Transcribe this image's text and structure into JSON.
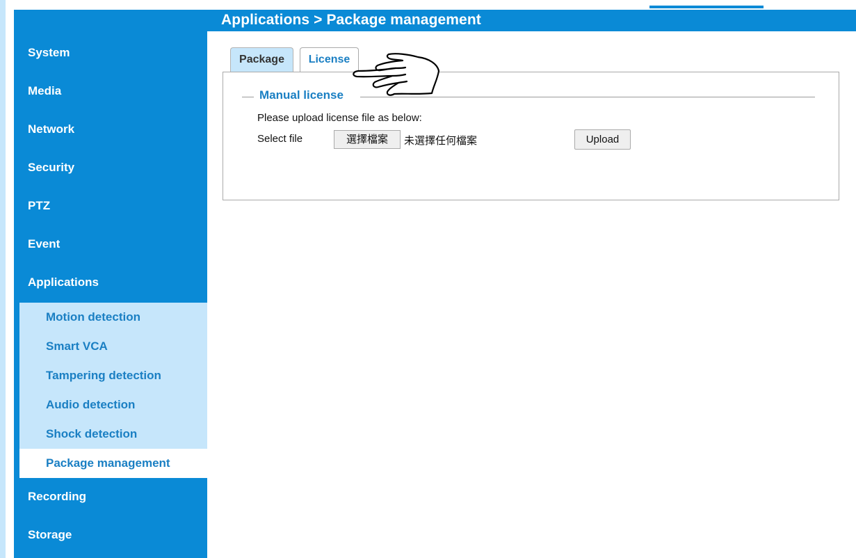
{
  "header": {
    "breadcrumb": "Applications  > Package management"
  },
  "sidebar": {
    "items": [
      {
        "label": "System"
      },
      {
        "label": "Media"
      },
      {
        "label": "Network"
      },
      {
        "label": "Security"
      },
      {
        "label": "PTZ"
      },
      {
        "label": "Event"
      },
      {
        "label": "Applications"
      },
      {
        "label": "Recording"
      },
      {
        "label": "Storage"
      }
    ],
    "submenu": [
      {
        "label": "Motion detection"
      },
      {
        "label": "Smart VCA"
      },
      {
        "label": "Tampering detection"
      },
      {
        "label": "Audio detection"
      },
      {
        "label": "Shock detection"
      },
      {
        "label": "Package management",
        "active": true
      }
    ]
  },
  "tabs": [
    {
      "label": "Package"
    },
    {
      "label": "License",
      "active": true
    }
  ],
  "license": {
    "legend": "Manual license",
    "description": "Please upload license file as below:",
    "select_file_label": "Select file",
    "choose_file_button": "選擇檔案",
    "file_status": "未選擇任何檔案",
    "upload_button": "Upload"
  },
  "icons": {
    "pointer": "hand-pointer-icon"
  },
  "colors": {
    "accent": "#0a8ad6",
    "submenu_bg": "#c6e6fb",
    "link_text": "#1a7fc3"
  }
}
